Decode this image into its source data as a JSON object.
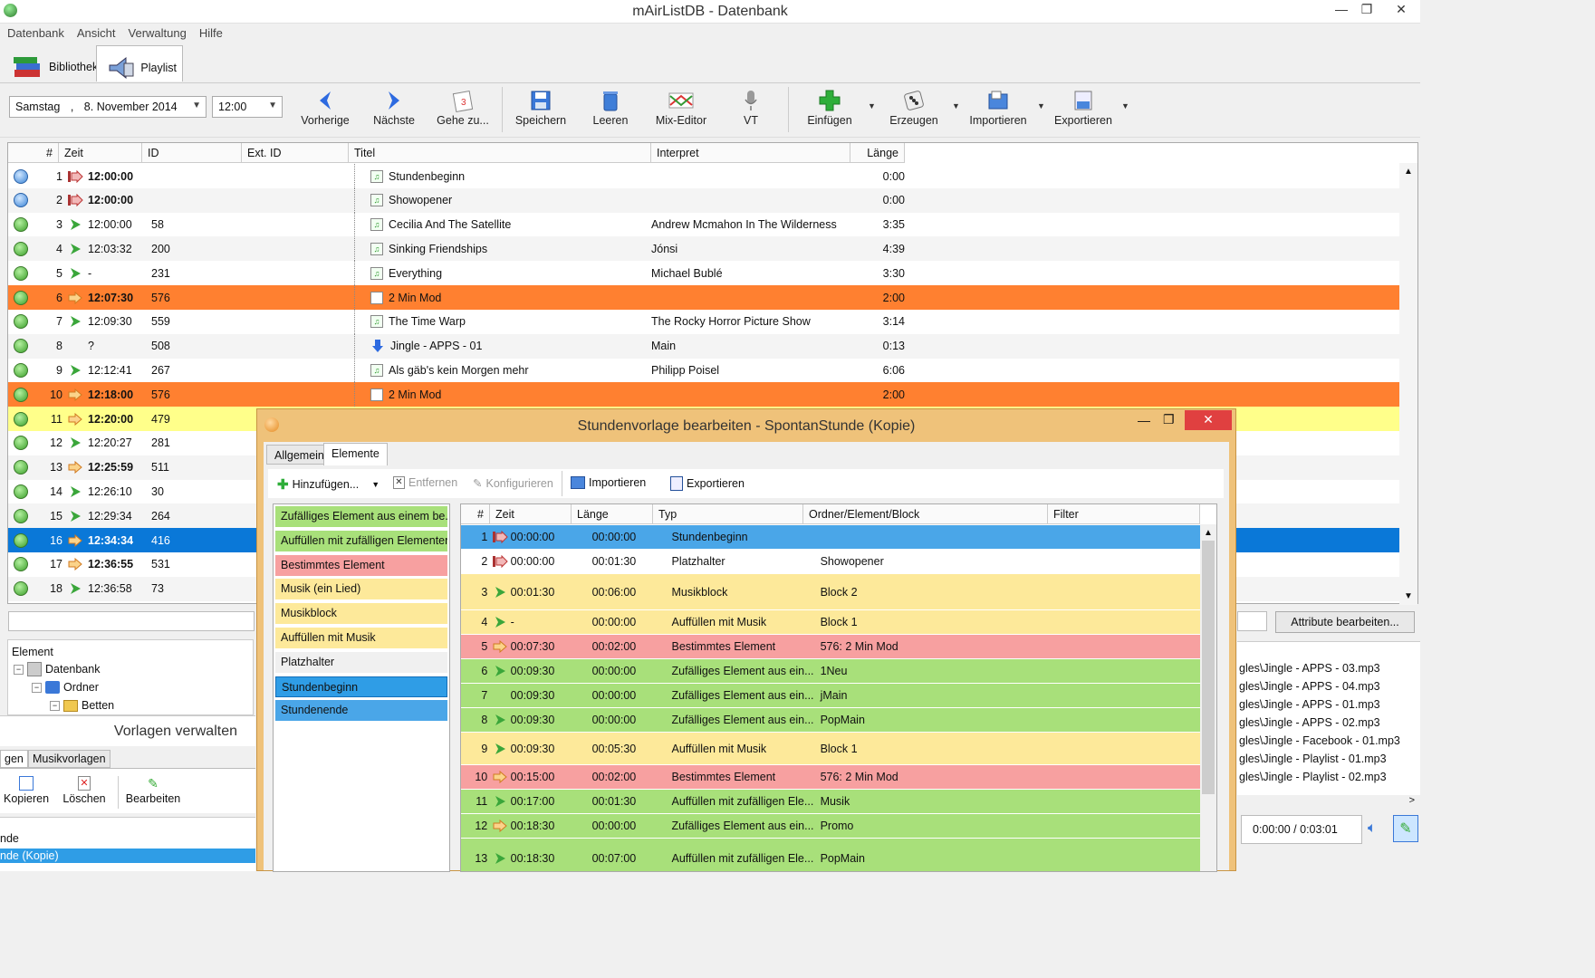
{
  "window": {
    "title": "mAirListDB - Datenbank",
    "min": "—",
    "max": "❐",
    "close": "✕"
  },
  "menu": [
    "Datenbank",
    "Ansicht",
    "Verwaltung",
    "Hilfe"
  ],
  "tabs": {
    "library": "Bibliothek",
    "playlist": "Playlist"
  },
  "toolbar": {
    "date_day": "Samstag",
    "date_sep": ",",
    "date_value": "8. November 2014",
    "time_value": "12:00",
    "prev": "Vorherige",
    "next": "Nächste",
    "goto": "Gehe zu...",
    "save": "Speichern",
    "clear": "Leeren",
    "mix": "Mix-Editor",
    "vt": "VT",
    "insert": "Einfügen",
    "generate": "Erzeugen",
    "import": "Importieren",
    "export": "Exportieren"
  },
  "grid": {
    "headers": [
      "#",
      "Zeit",
      "ID",
      "Ext. ID",
      "Titel",
      "Interpret",
      "Länge"
    ],
    "rows": [
      {
        "n": "1",
        "icon": "stop",
        "time": "12:00:00",
        "bold": true,
        "id": "",
        "title": "Stundenbeginn",
        "titleicon": "note",
        "artist": "",
        "len": "0:00",
        "dot": "b",
        "cls": ""
      },
      {
        "n": "2",
        "icon": "stop",
        "time": "12:00:00",
        "bold": true,
        "id": "",
        "title": "Showopener",
        "titleicon": "note",
        "artist": "",
        "len": "0:00",
        "dot": "b",
        "cls": "alt"
      },
      {
        "n": "3",
        "icon": "play",
        "time": "12:00:00",
        "bold": false,
        "id": "58",
        "title": "Cecilia And The Satellite",
        "titleicon": "note",
        "artist": "Andrew Mcmahon In The Wilderness",
        "len": "3:35",
        "dot": "g",
        "cls": ""
      },
      {
        "n": "4",
        "icon": "play",
        "time": "12:03:32",
        "bold": false,
        "id": "200",
        "title": "Sinking Friendships",
        "titleicon": "note",
        "artist": "Jónsi",
        "len": "4:39",
        "dot": "g",
        "cls": "alt"
      },
      {
        "n": "5",
        "icon": "play",
        "time": "-",
        "bold": false,
        "id": "231",
        "title": "Everything",
        "titleicon": "note",
        "artist": "Michael Bublé",
        "len": "3:30",
        "dot": "g",
        "cls": ""
      },
      {
        "n": "6",
        "icon": "fixed",
        "time": "12:07:30",
        "bold": true,
        "id": "576",
        "title": "2 Min Mod",
        "titleicon": "box",
        "artist": "",
        "len": "2:00",
        "dot": "g",
        "cls": "orange"
      },
      {
        "n": "7",
        "icon": "play",
        "time": "12:09:30",
        "bold": false,
        "id": "559",
        "title": "The Time Warp",
        "titleicon": "note",
        "artist": "The Rocky Horror Picture Show",
        "len": "3:14",
        "dot": "g",
        "cls": ""
      },
      {
        "n": "8",
        "icon": "none",
        "time": "?",
        "bold": false,
        "id": "508",
        "title": "Jingle - APPS - 01",
        "titleicon": "jingle",
        "artist": "Main",
        "len": "0:13",
        "dot": "g",
        "cls": "alt"
      },
      {
        "n": "9",
        "icon": "play",
        "time": "12:12:41",
        "bold": false,
        "id": "267",
        "title": "Als gäb's kein Morgen mehr",
        "titleicon": "note",
        "artist": "Philipp Poisel",
        "len": "6:06",
        "dot": "g",
        "cls": ""
      },
      {
        "n": "10",
        "icon": "fixed",
        "time": "12:18:00",
        "bold": true,
        "id": "576",
        "title": "2 Min Mod",
        "titleicon": "box",
        "artist": "",
        "len": "2:00",
        "dot": "g",
        "cls": "orange"
      },
      {
        "n": "11",
        "icon": "fixed",
        "time": "12:20:00",
        "bold": true,
        "id": "479",
        "title": "",
        "titleicon": "",
        "artist": "",
        "len": "",
        "dot": "g",
        "cls": "yellow"
      },
      {
        "n": "12",
        "icon": "play",
        "time": "12:20:27",
        "bold": false,
        "id": "281",
        "title": "",
        "titleicon": "",
        "artist": "",
        "len": "",
        "dot": "g",
        "cls": ""
      },
      {
        "n": "13",
        "icon": "fixed",
        "time": "12:25:59",
        "bold": true,
        "id": "511",
        "title": "",
        "titleicon": "",
        "artist": "",
        "len": "",
        "dot": "g",
        "cls": "alt"
      },
      {
        "n": "14",
        "icon": "play",
        "time": "12:26:10",
        "bold": false,
        "id": "30",
        "title": "",
        "titleicon": "",
        "artist": "",
        "len": "",
        "dot": "g",
        "cls": ""
      },
      {
        "n": "15",
        "icon": "play",
        "time": "12:29:34",
        "bold": false,
        "id": "264",
        "title": "",
        "titleicon": "",
        "artist": "",
        "len": "",
        "dot": "g",
        "cls": "alt"
      },
      {
        "n": "16",
        "icon": "fixed",
        "time": "12:34:34",
        "bold": true,
        "id": "416",
        "title": "",
        "titleicon": "",
        "artist": "",
        "len": "",
        "dot": "g",
        "cls": "blue"
      },
      {
        "n": "17",
        "icon": "fixed",
        "time": "12:36:55",
        "bold": true,
        "id": "531",
        "title": "",
        "titleicon": "",
        "artist": "",
        "len": "",
        "dot": "g",
        "cls": ""
      },
      {
        "n": "18",
        "icon": "play",
        "time": "12:36:58",
        "bold": false,
        "id": "73",
        "title": "",
        "titleicon": "",
        "artist": "",
        "len": "",
        "dot": "g",
        "cls": "alt"
      }
    ]
  },
  "attr_button": "Attribute bearbeiten...",
  "tree": {
    "header": "Element",
    "items": [
      "Datenbank",
      "Ordner",
      "Betten"
    ]
  },
  "templates": {
    "title": "Vorlagen verwalten",
    "tab1": "gen",
    "tab2": "Musikvorlagen",
    "copy": "Kopieren",
    "delete": "Löschen",
    "edit": "Bearbeiten",
    "item1": "nde",
    "item2": "nde (Kopie)"
  },
  "files": [
    "gles\\Jingle - APPS - 03.mp3",
    "gles\\Jingle - APPS - 04.mp3",
    "gles\\Jingle - APPS - 01.mp3",
    "gles\\Jingle - APPS - 02.mp3",
    "gles\\Jingle - Facebook - 01.mp3",
    "gles\\Jingle - Playlist - 01.mp3",
    "gles\\Jingle - Playlist - 02.mp3"
  ],
  "player": {
    "time": "0:00:00 / 0:03:01"
  },
  "dialog": {
    "title": "Stundenvorlage bearbeiten - SpontanStunde (Kopie)",
    "tabs": [
      "Allgemein",
      "Elemente"
    ],
    "toolbar": {
      "add": "Hinzufügen...",
      "remove": "Entfernen",
      "configure": "Konfigurieren",
      "import": "Importieren",
      "export": "Exportieren"
    },
    "palette": [
      {
        "label": "Zufälliges Element aus einem be...",
        "cls": "c-lgreen"
      },
      {
        "label": "Auffüllen mit zufälligen Elementen",
        "cls": "c-lgreen"
      },
      {
        "label": "Bestimmtes Element",
        "cls": "c-pink"
      },
      {
        "label": "Musik (ein Lied)",
        "cls": "c-yellow"
      },
      {
        "label": "Musikblock",
        "cls": "c-yellow"
      },
      {
        "label": "Auffüllen mit Musik",
        "cls": "c-yellow"
      },
      {
        "label": "Platzhalter",
        "cls": "c-gray"
      },
      {
        "label": "Stundenbeginn",
        "cls": "c-sel"
      },
      {
        "label": "Stundenende",
        "cls": "c-blue"
      }
    ],
    "headers": [
      "#",
      "Zeit",
      "Länge",
      "Typ",
      "Ordner/Element/Block",
      "Filter"
    ],
    "rows": [
      {
        "n": "1",
        "icon": "stop",
        "zeit": "00:00:00",
        "len": "00:00:00",
        "typ": "Stundenbeginn",
        "ord": "",
        "h": 27,
        "cls": "c-blue"
      },
      {
        "n": "2",
        "icon": "stop",
        "zeit": "00:00:00",
        "len": "00:01:30",
        "typ": "Platzhalter",
        "ord": "Showopener",
        "h": 27,
        "cls": "c-white"
      },
      {
        "n": "3",
        "icon": "play",
        "zeit": "00:01:30",
        "len": "00:06:00",
        "typ": "Musikblock",
        "ord": "Block 2",
        "h": 40,
        "cls": "c-yellow"
      },
      {
        "n": "4",
        "icon": "play",
        "zeit": "-",
        "len": "00:00:00",
        "typ": "Auffüllen mit Musik",
        "ord": "Block 1",
        "h": 27,
        "cls": "c-yellow"
      },
      {
        "n": "5",
        "icon": "fixed",
        "zeit": "00:07:30",
        "len": "00:02:00",
        "typ": "Bestimmtes Element",
        "ord": "576: 2 Min Mod",
        "h": 27,
        "cls": "c-pink"
      },
      {
        "n": "6",
        "icon": "play",
        "zeit": "00:09:30",
        "len": "00:00:00",
        "typ": "Zufälliges Element aus ein...",
        "ord": "1Neu",
        "h": 27,
        "cls": "c-lgreen"
      },
      {
        "n": "7",
        "icon": "none",
        "zeit": "00:09:30",
        "len": "00:00:00",
        "typ": "Zufälliges Element aus ein...",
        "ord": "jMain",
        "h": 27,
        "cls": "c-lgreen"
      },
      {
        "n": "8",
        "icon": "play",
        "zeit": "00:09:30",
        "len": "00:00:00",
        "typ": "Zufälliges Element aus ein...",
        "ord": "PopMain",
        "h": 27,
        "cls": "c-lgreen"
      },
      {
        "n": "9",
        "icon": "play",
        "zeit": "00:09:30",
        "len": "00:05:30",
        "typ": "Auffüllen mit Musik",
        "ord": "Block 1",
        "h": 36,
        "cls": "c-yellow"
      },
      {
        "n": "10",
        "icon": "fixed",
        "zeit": "00:15:00",
        "len": "00:02:00",
        "typ": "Bestimmtes Element",
        "ord": "576: 2 Min Mod",
        "h": 27,
        "cls": "c-pink"
      },
      {
        "n": "11",
        "icon": "play",
        "zeit": "00:17:00",
        "len": "00:01:30",
        "typ": "Auffüllen mit zufälligen Ele...",
        "ord": "Musik",
        "h": 27,
        "cls": "c-lgreen"
      },
      {
        "n": "12",
        "icon": "fixed",
        "zeit": "00:18:30",
        "len": "00:00:00",
        "typ": "Zufälliges Element aus ein...",
        "ord": "Promo",
        "h": 27,
        "cls": "c-lgreen"
      },
      {
        "n": "13",
        "icon": "play",
        "zeit": "00:18:30",
        "len": "00:07:00",
        "typ": "Auffüllen mit zufälligen Ele...",
        "ord": "PopMain",
        "h": 45,
        "cls": "c-lgreen"
      }
    ]
  }
}
